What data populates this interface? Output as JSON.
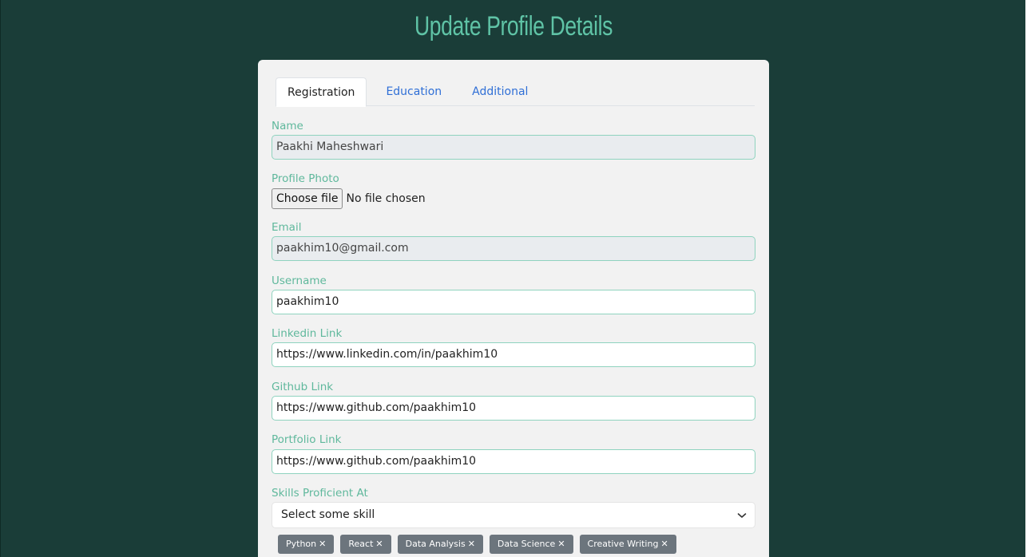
{
  "page": {
    "title": "Update Profile Details"
  },
  "tabs": [
    {
      "label": "Registration",
      "active": true
    },
    {
      "label": "Education",
      "active": false
    },
    {
      "label": "Additional",
      "active": false
    }
  ],
  "form": {
    "name": {
      "label": "Name",
      "value": "Paakhi Maheshwari"
    },
    "photo": {
      "label": "Profile Photo",
      "button": "Choose file",
      "status": "No file chosen"
    },
    "email": {
      "label": "Email",
      "value": "paakhim10@gmail.com"
    },
    "username": {
      "label": "Username",
      "value": "paakhim10"
    },
    "linkedin": {
      "label": "Linkedin Link",
      "value": "https://www.linkedin.com/in/paakhim10"
    },
    "github": {
      "label": "Github Link",
      "value": "https://www.github.com/paakhim10"
    },
    "portfolio": {
      "label": "Portfolio Link",
      "value": "https://www.github.com/paakhim10"
    },
    "skills": {
      "label": "Skills Proficient At",
      "placeholder": "Select some skill",
      "selected": [
        "Python",
        "React",
        "Data Analysis",
        "Data Science",
        "Creative Writing"
      ],
      "remove_glyph": "✕"
    }
  },
  "colors": {
    "background": "#1a3d38",
    "accent": "#5fc3a6",
    "tab_link": "#2f6fd6",
    "chip": "#6c757d"
  },
  "icons": {
    "dropdown": "chevron-down-icon",
    "chip_remove": "close-icon"
  }
}
